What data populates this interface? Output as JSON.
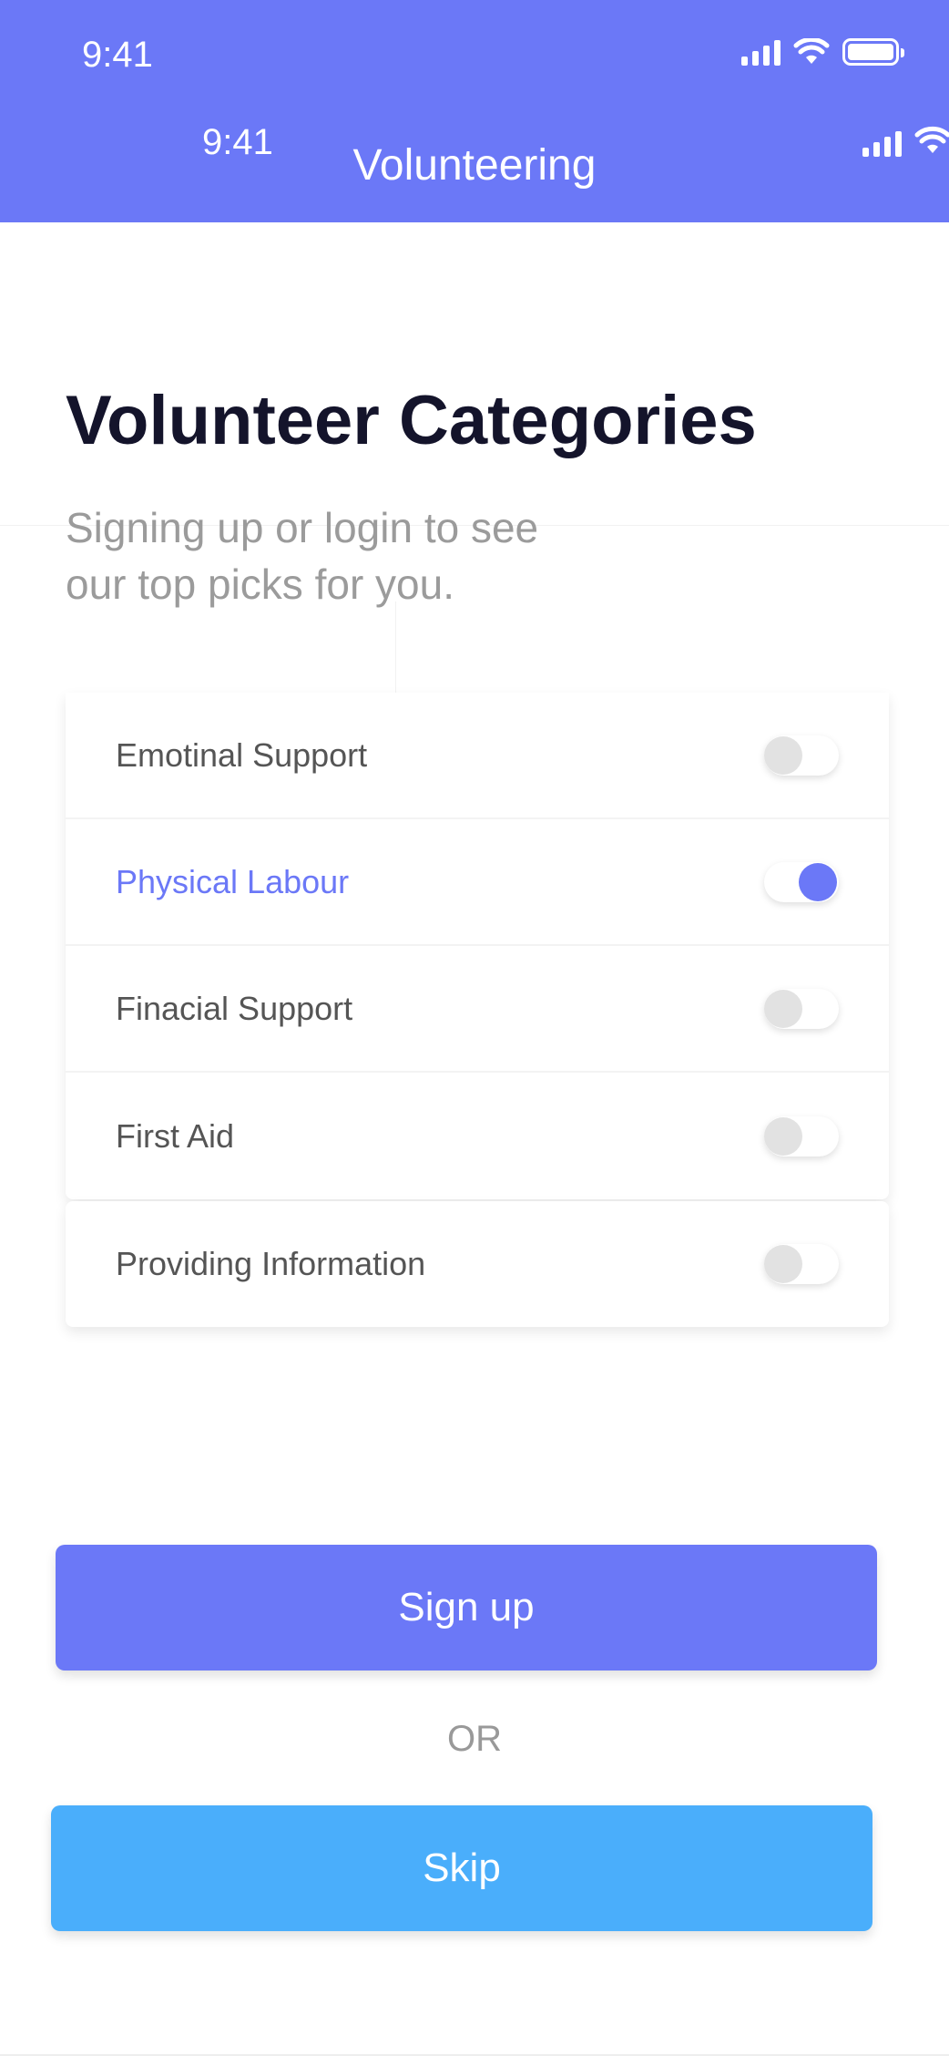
{
  "status_bar": {
    "time": "9:41"
  },
  "header": {
    "inner_time": "9:41",
    "title": "Volunteering"
  },
  "main": {
    "title": "Volunteer Categories",
    "subtitle_line1": "Signing up or login to see",
    "subtitle_line2": "our top picks for you."
  },
  "categories": [
    {
      "label": "Emotinal Support",
      "enabled": false
    },
    {
      "label": "Physical Labour",
      "enabled": true
    },
    {
      "label": "Finacial Support",
      "enabled": false
    },
    {
      "label": "First Aid",
      "enabled": false
    },
    {
      "label": "Providing Information",
      "enabled": false
    }
  ],
  "actions": {
    "signup_label": "Sign up",
    "or_label": "OR",
    "skip_label": "Skip"
  },
  "colors": {
    "accent": "#6b78f7",
    "skip": "#4aaefb",
    "toggle_off": "#e2e2e2"
  }
}
